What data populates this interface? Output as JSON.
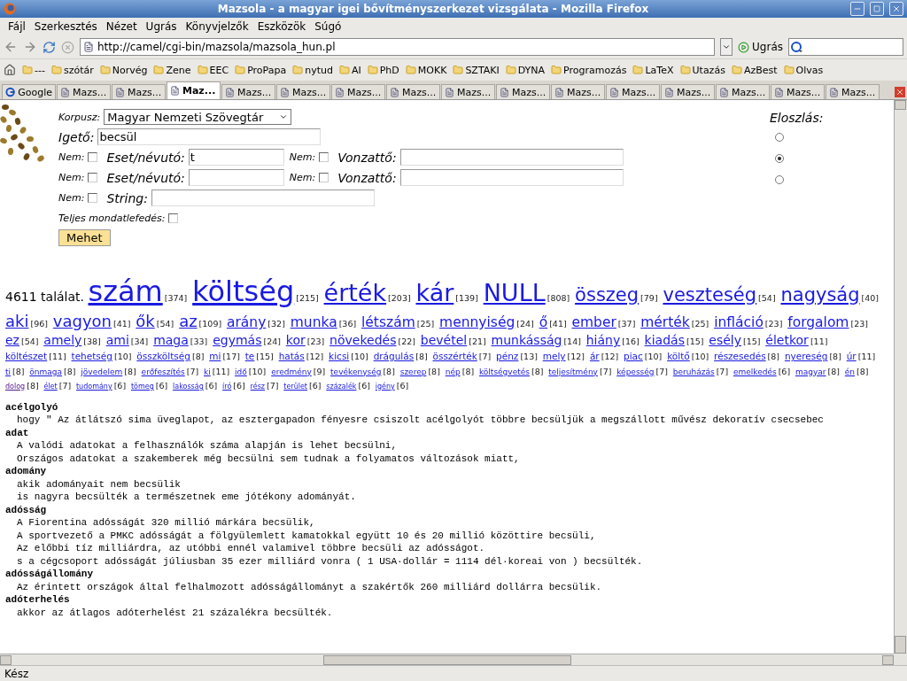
{
  "window": {
    "title": "Mazsola - a magyar igei bővítményszerkezet vizsgálata - Mozilla Firefox"
  },
  "menu": [
    "Fájl",
    "Szerkesztés",
    "Nézet",
    "Ugrás",
    "Könyvjelzők",
    "Eszközök",
    "Súgó"
  ],
  "navigation": {
    "url": "http://camel/cgi-bin/mazsola/mazsola_hun.pl",
    "go_label": "Ugrás"
  },
  "bookmarks": [
    "---",
    "szótár",
    "Norvég",
    "Zene",
    "EEC",
    "ProPapa",
    "nytud",
    "AI",
    "PhD",
    "MOKK",
    "SZTAKI",
    "DYNA",
    "Programozás",
    "LaTeX",
    "Utazás",
    "AzBest",
    "Olvas"
  ],
  "tabs": [
    {
      "label": "Google",
      "selected": false,
      "kind": "search"
    },
    {
      "label": "Mazs...",
      "selected": false,
      "kind": "page"
    },
    {
      "label": "Mazs...",
      "selected": false,
      "kind": "page"
    },
    {
      "label": "Maz...",
      "selected": true,
      "kind": "page"
    },
    {
      "label": "Mazs...",
      "selected": false,
      "kind": "page"
    },
    {
      "label": "Mazs...",
      "selected": false,
      "kind": "page"
    },
    {
      "label": "Mazs...",
      "selected": false,
      "kind": "page"
    },
    {
      "label": "Mazs...",
      "selected": false,
      "kind": "page"
    },
    {
      "label": "Mazs...",
      "selected": false,
      "kind": "page"
    },
    {
      "label": "Mazs...",
      "selected": false,
      "kind": "page"
    },
    {
      "label": "Mazs...",
      "selected": false,
      "kind": "page"
    },
    {
      "label": "Mazs...",
      "selected": false,
      "kind": "page"
    },
    {
      "label": "Mazs...",
      "selected": false,
      "kind": "page"
    },
    {
      "label": "Mazs...",
      "selected": false,
      "kind": "page"
    },
    {
      "label": "Mazs...",
      "selected": false,
      "kind": "page"
    },
    {
      "label": "Mazs...",
      "selected": false,
      "kind": "page"
    }
  ],
  "form": {
    "corpus_label": "Korpusz:",
    "corpus_value": "Magyar Nemzeti Szövegtár",
    "verb_label": "Igető:",
    "verb_value": "becsül",
    "rows": [
      {
        "neg_label": "Nem:",
        "neg_checked": false,
        "label": "Eset/névutó:",
        "value": "t",
        "neg2_label": "Nem:",
        "neg2_checked": false,
        "label2": "Vonzattő:"
      },
      {
        "neg_label": "Nem:",
        "neg_checked": false,
        "label": "Eset/névutó:",
        "neg2_label": "Nem:",
        "neg2_checked": false,
        "label2": "Vonzattő:"
      }
    ],
    "string_row": {
      "neg_label": "Nem:",
      "neg_checked": false,
      "label": "String:"
    },
    "full_label": "Teljes mondatlefedés:",
    "full_checked": false,
    "submit": "Mehet",
    "distribution_label": "Eloszlás:",
    "distribution": [
      {
        "selected": false
      },
      {
        "selected": true
      },
      {
        "selected": false
      }
    ]
  },
  "results": {
    "count": "4611 találat.",
    "cloud": [
      {
        "word": "szám",
        "count": "[374]",
        "kind": "xxl",
        "visited": false
      },
      {
        "word": "költség",
        "count": "[215]",
        "kind": "xxl",
        "visited": false
      },
      {
        "word": "érték",
        "count": "[203]",
        "kind": "xl",
        "visited": false
      },
      {
        "word": "kár",
        "count": "[139]",
        "kind": "xl",
        "visited": false
      },
      {
        "word": "NULL",
        "count": "[808]",
        "kind": "xl",
        "visited": false
      },
      {
        "word": "összeg",
        "count": "[79]",
        "kind": "l",
        "visited": false
      },
      {
        "word": "veszteség",
        "count": "[54]",
        "kind": "l",
        "visited": false
      },
      {
        "word": "nagyság",
        "count": "[40]",
        "kind": "l",
        "visited": false
      },
      {
        "word": "aki",
        "count": "[96]",
        "kind": "m",
        "visited": false
      },
      {
        "word": "vagyon",
        "count": "[41]",
        "kind": "m",
        "visited": false
      },
      {
        "word": "ők",
        "count": "[54]",
        "kind": "m",
        "visited": false
      },
      {
        "word": "az",
        "count": "[109]",
        "kind": "m",
        "visited": false
      },
      {
        "word": "arány",
        "count": "[32]",
        "kind": "ml",
        "visited": false
      },
      {
        "word": "munka",
        "count": "[36]",
        "kind": "ml",
        "visited": false
      },
      {
        "word": "létszám",
        "count": "[25]",
        "kind": "ml",
        "visited": false
      },
      {
        "word": "mennyiség",
        "count": "[24]",
        "kind": "ml",
        "visited": false
      },
      {
        "word": "ő",
        "count": "[41]",
        "kind": "ml",
        "visited": false
      },
      {
        "word": "ember",
        "count": "[37]",
        "kind": "ml",
        "visited": false
      },
      {
        "word": "mérték",
        "count": "[25]",
        "kind": "ml",
        "visited": false
      },
      {
        "word": "infláció",
        "count": "[23]",
        "kind": "ml",
        "visited": false
      },
      {
        "word": "forgalom",
        "count": "[23]",
        "kind": "ml",
        "visited": false
      },
      {
        "word": "ez",
        "count": "[54]",
        "kind": "s",
        "visited": false
      },
      {
        "word": "amely",
        "count": "[38]",
        "kind": "s",
        "visited": false
      },
      {
        "word": "ami",
        "count": "[34]",
        "kind": "s",
        "visited": false
      },
      {
        "word": "maga",
        "count": "[33]",
        "kind": "s",
        "visited": false
      },
      {
        "word": "egymás",
        "count": "[24]",
        "kind": "s",
        "visited": false
      },
      {
        "word": "kor",
        "count": "[23]",
        "kind": "s",
        "visited": false
      },
      {
        "word": "növekedés",
        "count": "[22]",
        "kind": "s",
        "visited": false
      },
      {
        "word": "bevétel",
        "count": "[21]",
        "kind": "s",
        "visited": false
      },
      {
        "word": "munkásság",
        "count": "[14]",
        "kind": "s",
        "visited": false
      },
      {
        "word": "hiány",
        "count": "[16]",
        "kind": "s",
        "visited": false
      },
      {
        "word": "kiadás",
        "count": "[15]",
        "kind": "s",
        "visited": false
      },
      {
        "word": "esély",
        "count": "[15]",
        "kind": "s",
        "visited": false
      },
      {
        "word": "életkor",
        "count": "[11]",
        "kind": "s",
        "visited": false
      },
      {
        "word": "költészet",
        "count": "[11]",
        "kind": "xs",
        "visited": false
      },
      {
        "word": "tehetség",
        "count": "[10]",
        "kind": "xs",
        "visited": false
      },
      {
        "word": "összköltség",
        "count": "[8]",
        "kind": "xs",
        "visited": false
      },
      {
        "word": "mi",
        "count": "[17]",
        "kind": "xs",
        "visited": false
      },
      {
        "word": "te",
        "count": "[15]",
        "kind": "xs",
        "visited": false
      },
      {
        "word": "hatás",
        "count": "[12]",
        "kind": "xs",
        "visited": false
      },
      {
        "word": "kicsi",
        "count": "[10]",
        "kind": "xs",
        "visited": false
      },
      {
        "word": "drágulás",
        "count": "[8]",
        "kind": "xs",
        "visited": false
      },
      {
        "word": "összérték",
        "count": "[7]",
        "kind": "xs",
        "visited": false
      },
      {
        "word": "pénz",
        "count": "[13]",
        "kind": "xs",
        "visited": false
      },
      {
        "word": "mely",
        "count": "[12]",
        "kind": "xs",
        "visited": false
      },
      {
        "word": "ár",
        "count": "[12]",
        "kind": "xs",
        "visited": false
      },
      {
        "word": "piac",
        "count": "[10]",
        "kind": "xs",
        "visited": false
      },
      {
        "word": "költő",
        "count": "[10]",
        "kind": "xs",
        "visited": false
      },
      {
        "word": "részesedés",
        "count": "[8]",
        "kind": "xs",
        "visited": false
      },
      {
        "word": "nyereség",
        "count": "[8]",
        "kind": "xs",
        "visited": false
      },
      {
        "word": "úr",
        "count": "[11]",
        "kind": "xs",
        "visited": false
      },
      {
        "word": "ti",
        "count": "[8]",
        "kind": "xxs",
        "visited": false
      },
      {
        "word": "önmaga",
        "count": "[8]",
        "kind": "xxs",
        "visited": false
      },
      {
        "word": "jövedelem",
        "count": "[8]",
        "kind": "xxs",
        "visited": false
      },
      {
        "word": "erőfeszítés",
        "count": "[7]",
        "kind": "xxs",
        "visited": false
      },
      {
        "word": "ki",
        "count": "[11]",
        "kind": "xxs",
        "visited": false
      },
      {
        "word": "idő",
        "count": "[10]",
        "kind": "xxs",
        "visited": false
      },
      {
        "word": "eredmény",
        "count": "[9]",
        "kind": "xxs",
        "visited": false
      },
      {
        "word": "tevékenység",
        "count": "[8]",
        "kind": "xxs",
        "visited": false
      },
      {
        "word": "szerep",
        "count": "[8]",
        "kind": "xxs",
        "visited": false
      },
      {
        "word": "nép",
        "count": "[8]",
        "kind": "xxs",
        "visited": false
      },
      {
        "word": "költségvetés",
        "count": "[8]",
        "kind": "xxs",
        "visited": false
      },
      {
        "word": "teljesítmény",
        "count": "[7]",
        "kind": "xxs",
        "visited": false
      },
      {
        "word": "képesség",
        "count": "[7]",
        "kind": "xxs",
        "visited": false
      },
      {
        "word": "beruházás",
        "count": "[7]",
        "kind": "xxs",
        "visited": false
      },
      {
        "word": "emelkedés",
        "count": "[6]",
        "kind": "xxs",
        "visited": false
      },
      {
        "word": "magyar",
        "count": "[8]",
        "kind": "xxs",
        "visited": false
      },
      {
        "word": "én",
        "count": "[8]",
        "kind": "xxs",
        "visited": false
      },
      {
        "word": "dolog",
        "count": "[8]",
        "kind": "tiny",
        "visited": true
      },
      {
        "word": "élet",
        "count": "[7]",
        "kind": "tiny",
        "visited": false
      },
      {
        "word": "tudomány",
        "count": "[6]",
        "kind": "tiny",
        "visited": false
      },
      {
        "word": "tömeg",
        "count": "[6]",
        "kind": "tiny",
        "visited": false
      },
      {
        "word": "lakosság",
        "count": "[6]",
        "kind": "tiny",
        "visited": false
      },
      {
        "word": "író",
        "count": "[6]",
        "kind": "tiny",
        "visited": false
      },
      {
        "word": "rész",
        "count": "[7]",
        "kind": "tiny",
        "visited": false
      },
      {
        "word": "terület",
        "count": "[6]",
        "kind": "tiny",
        "visited": false
      },
      {
        "word": "százalék",
        "count": "[6]",
        "kind": "tiny",
        "visited": false
      },
      {
        "word": "igény",
        "count": "[6]",
        "kind": "tiny",
        "visited": false
      }
    ],
    "concordance": [
      {
        "lemma": "acélgolyó",
        "lines": [
          "hogy \" Az átlátszó sima üveglapot, az esztergapadon fényesre csiszolt acélgolyót többre becsüljük a megszállott művész dekoratív csecsebec"
        ]
      },
      {
        "lemma": "adat",
        "lines": [
          "A valódi adatokat a felhasználók száma alapján is lehet becsülni,",
          "Országos adatokat a szakemberek még becsülni sem tudnak a folyamatos változások miatt,"
        ]
      },
      {
        "lemma": "adomány",
        "lines": [
          "akik adományait nem becsülik",
          "is nagyra becsülték a természetnek eme jótékony adományát."
        ]
      },
      {
        "lemma": "adósság",
        "lines": [
          "A Fiorentina adósságát 320 millió márkára becsülik,",
          "A sportvezető a PMKC adósságát a fölgyülemlett kamatokkal együtt 10 és 20 millió közöttire becsüli,",
          "Az előbbi tíz milliárdra, az utóbbi ennél valamivel többre becsüli az adósságot.",
          "s a cégcsoport adósságát júliusban 35 ezer milliárd vonra ( 1 USA·dollár = 1114 dél·koreai von ) becsülték."
        ]
      },
      {
        "lemma": "adósságállomány",
        "lines": [
          "Az érintett országok által felhalmozott adósságállományt a szakértők 260 milliárd dollárra becsülik."
        ]
      },
      {
        "lemma": "adóterhelés",
        "lines": [
          "akkor az átlagos adóterhelést 21 százalékra becsülték."
        ]
      }
    ]
  },
  "status_bar": "Kész"
}
